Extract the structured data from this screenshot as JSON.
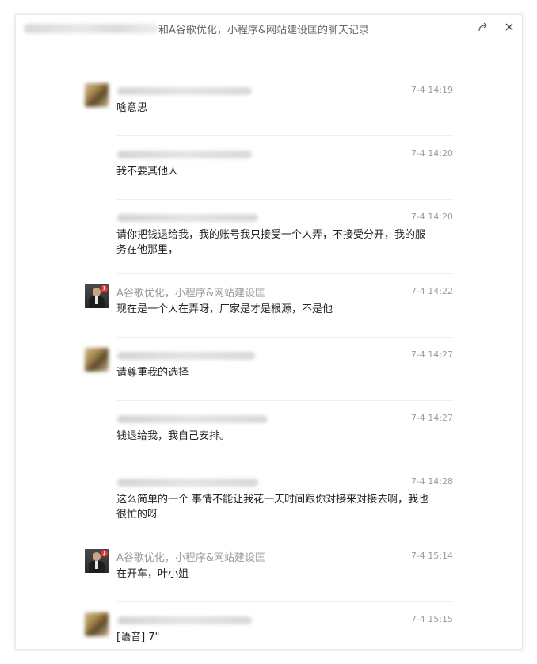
{
  "window": {
    "title": "和A谷歌优化，小程序&网站建设匡的聊天记录",
    "share_icon": "share-arrow-icon",
    "close_icon": "close-icon"
  },
  "messages": [
    {
      "sender": "",
      "time": "7-4 14:19",
      "text": "啥意思"
    },
    {
      "sender": "",
      "time": "7-4 14:20",
      "text": "我不要其他人"
    },
    {
      "sender": "",
      "time": "7-4 14:20",
      "text": "请你把钱退给我，我的账号我只接受一个人弄，不接受分开，我的服务在他那里，"
    },
    {
      "sender": "A谷歌优化，小程序&网站建设匡",
      "time": "7-4 14:22",
      "text": "现在是一个人在弄呀，厂家是才是根源，不是他"
    },
    {
      "sender": "",
      "time": "7-4 14:27",
      "text": "请尊重我的选择"
    },
    {
      "sender": "",
      "time": "7-4 14:27",
      "text": "钱退给我，我自己安排。"
    },
    {
      "sender": "",
      "time": "7-4 14:28",
      "text": "这么简单的一个 事情不能让我花一天时间跟你对接来对接去啊，我也很忙的呀"
    },
    {
      "sender": "A谷歌优化，小程序&网站建设匡",
      "time": "7-4 15:14",
      "text": "在开车，叶小姐"
    },
    {
      "sender": "",
      "time": "7-4 15:15",
      "text": "[语音] 7\""
    }
  ],
  "badge_count": "1"
}
